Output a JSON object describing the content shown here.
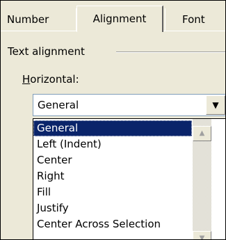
{
  "tabs": {
    "number": "Number",
    "alignment": "Alignment",
    "font": "Font"
  },
  "group": {
    "label": "Text alignment"
  },
  "horizontal": {
    "label_prefix": "H",
    "label_rest": "orizontal:",
    "value": "General",
    "options": [
      "General",
      "Left (Indent)",
      "Center",
      "Right",
      "Fill",
      "Justify",
      "Center Across Selection"
    ]
  },
  "icons": {
    "dropdown": "chevron-down-icon",
    "scroll_up": "scroll-up-icon",
    "scroll_down": "scroll-down-icon"
  },
  "colors": {
    "selection": "#0a246a",
    "dialog_bg": "#ece9d8"
  }
}
